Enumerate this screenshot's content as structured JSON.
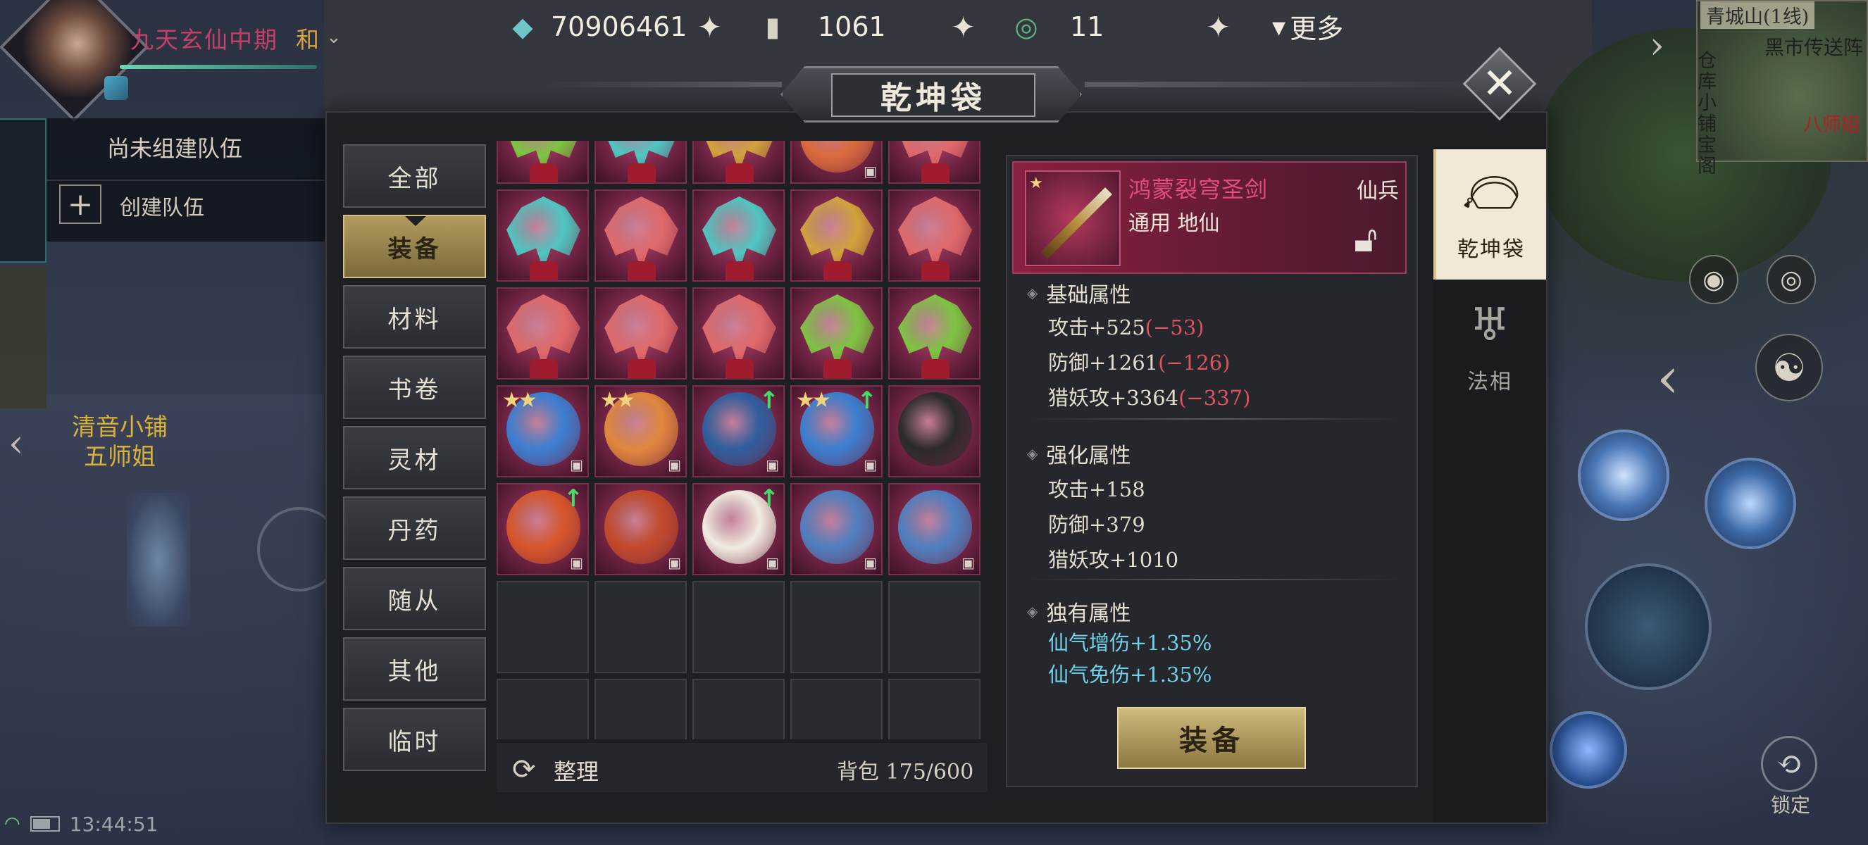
{
  "player": {
    "name": "九天玄仙中期",
    "suffix": "和"
  },
  "resources": [
    {
      "icon": "spirit-stone-icon",
      "value": "70906461"
    },
    {
      "icon": "scroll-token-icon",
      "value": "1061"
    },
    {
      "icon": "jade-ring-icon",
      "value": "11"
    }
  ],
  "more_label": "更多",
  "team": {
    "none_label": "尚未组建队伍",
    "create_label": "创建队伍"
  },
  "npc": {
    "line1": "清音小铺",
    "line2": "五师姐"
  },
  "status": {
    "time": "13:44:51"
  },
  "minimap": {
    "line": "青城山(1线)",
    "portal": "黑市传送阵",
    "labels": "仓库小铺宝阁",
    "right_label": "八师姐"
  },
  "right_hud": {
    "lock_label": "锁定"
  },
  "bag": {
    "title": "乾坤袋",
    "categories": [
      "全部",
      "装备",
      "材料",
      "书卷",
      "灵材",
      "丹药",
      "随从",
      "其他",
      "临时"
    ],
    "active_category": 1,
    "sort_label": "整理",
    "count_label": "背包 175/600",
    "items": [
      {
        "art": "green-dragon-icon",
        "color": "#7ec442",
        "base": true
      },
      {
        "art": "cyan-dragon-icon",
        "color": "#4fc6c1",
        "base": true
      },
      {
        "art": "gold-dragon-icon",
        "color": "#d1a23c",
        "base": true
      },
      {
        "art": "flame-orb-icon",
        "color": "#d96b3c",
        "lock": true
      },
      {
        "art": "red-dragon-icon",
        "color": "#e06a6a",
        "base": true
      },
      {
        "art": "cyan-dragon-icon",
        "color": "#4fc6c1",
        "base": true
      },
      {
        "art": "red-dragon-icon",
        "color": "#e06a6a",
        "base": true
      },
      {
        "art": "cyan-dragon-icon",
        "color": "#4fc6c1",
        "base": true
      },
      {
        "art": "gold-dragon-icon",
        "color": "#d1a23c",
        "base": true
      },
      {
        "art": "red-dragon-icon",
        "color": "#e06a6a",
        "base": true
      },
      {
        "art": "red-dragon-icon",
        "color": "#e06a6a",
        "base": true
      },
      {
        "art": "red-dragon-icon",
        "color": "#e06a6a",
        "base": true
      },
      {
        "art": "red-dragon-icon",
        "color": "#e06a6a",
        "base": true
      },
      {
        "art": "green-dragon-icon",
        "color": "#7ec442",
        "base": true
      },
      {
        "art": "green-dragon-icon",
        "color": "#7ec442",
        "base": true
      },
      {
        "art": "azure-gem-icon",
        "color": "#3b7fd1",
        "stars": 2,
        "lock": true
      },
      {
        "art": "flame-ring-icon",
        "color": "#e0883c",
        "stars": 2,
        "lock": true
      },
      {
        "art": "blue-ring-icon",
        "color": "#2e5e9e",
        "up": true,
        "lock": true
      },
      {
        "art": "blue-fan-icon",
        "color": "#3a7fd0",
        "stars": 2,
        "up": true,
        "lock": true
      },
      {
        "art": "black-bracelet-icon",
        "color": "#2a2a2a"
      },
      {
        "art": "fire-scroll-icon",
        "color": "#d8562a",
        "up": true,
        "lock": true
      },
      {
        "art": "red-scroll-icon",
        "color": "#c24a2a",
        "lock": true
      },
      {
        "art": "boot-icon",
        "color": "#f1ece0",
        "up": true,
        "lock": true
      },
      {
        "art": "blue-orb-icon",
        "color": "#4f7fc0",
        "lock": true
      },
      {
        "art": "blue-orb-icon",
        "color": "#4f7fc0",
        "lock": true
      }
    ],
    "detail": {
      "name": "鸿蒙裂穹圣剑",
      "rank": "仙兵",
      "type": "通用 地仙",
      "base_title": "基础属性",
      "base_attrs": [
        {
          "label": "攻击+525",
          "delta": "(−53)"
        },
        {
          "label": "防御+1261",
          "delta": "(−126)"
        },
        {
          "label": "猎妖攻+3364",
          "delta": "(−337)"
        }
      ],
      "enhance_title": "强化属性",
      "enhance_attrs": [
        "攻击+158",
        "防御+379",
        "猎妖攻+1010"
      ],
      "unique_title": "独有属性",
      "unique_attrs": [
        "仙气增伤+1.35%",
        "仙气免伤+1.35%"
      ],
      "equip_label": "装备"
    },
    "side_tabs": [
      {
        "icon": "pouch-icon",
        "label": "乾坤袋",
        "active": true
      },
      {
        "icon": "dharma-icon",
        "label": "法相",
        "active": false
      }
    ]
  },
  "colors": {
    "accent_gold": "#b29b5e",
    "item_red": "#e04c7d",
    "negative": "#e0535b",
    "unique_cyan": "#6fd2e8"
  }
}
